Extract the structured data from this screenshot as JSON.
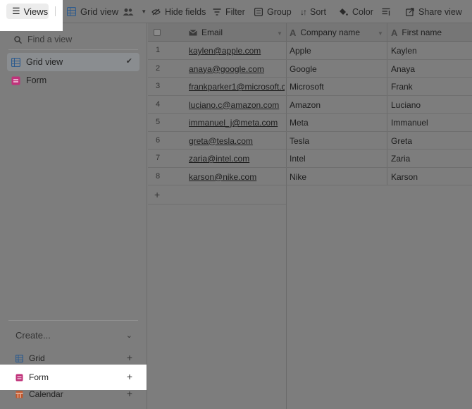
{
  "toolbar": {
    "views_label": "Views",
    "view_name": "Grid view",
    "hide_fields": "Hide fields",
    "filter": "Filter",
    "group": "Group",
    "sort": "Sort",
    "color": "Color",
    "share_view": "Share view"
  },
  "sidebar": {
    "find_placeholder": "Find a view",
    "views": [
      {
        "label": "Grid view",
        "icon": "grid-icon",
        "active": true
      },
      {
        "label": "Form",
        "icon": "form-icon",
        "active": false
      }
    ],
    "create_label": "Create...",
    "create_items": [
      {
        "label": "Grid",
        "icon": "grid-icon"
      },
      {
        "label": "Form",
        "icon": "form-icon"
      },
      {
        "label": "Calendar",
        "icon": "calendar-icon"
      }
    ]
  },
  "grid": {
    "columns": [
      "Email",
      "Company name",
      "First name"
    ],
    "rows": [
      {
        "num": "1",
        "email": "kaylen@apple.com",
        "company": "Apple",
        "first": "Kaylen"
      },
      {
        "num": "2",
        "email": "anaya@google.com",
        "company": "Google",
        "first": "Anaya"
      },
      {
        "num": "3",
        "email": "frankparker1@microsoft.c...",
        "company": "Microsoft",
        "first": "Frank"
      },
      {
        "num": "4",
        "email": "luciano.c@amazon.com",
        "company": "Amazon",
        "first": "Luciano"
      },
      {
        "num": "5",
        "email": "immanuel_j@meta.com",
        "company": "Meta",
        "first": "Immanuel"
      },
      {
        "num": "6",
        "email": "greta@tesla.com",
        "company": "Tesla",
        "first": "Greta"
      },
      {
        "num": "7",
        "email": "zaria@intel.com",
        "company": "Intel",
        "first": "Zaria"
      },
      {
        "num": "8",
        "email": "karson@nike.com",
        "company": "Nike",
        "first": "Karson"
      }
    ],
    "add_row": "+"
  },
  "colors": {
    "grid_icon": "#2d5b8e",
    "form_icon": "#c0327a",
    "calendar_icon": "#c2562a"
  }
}
